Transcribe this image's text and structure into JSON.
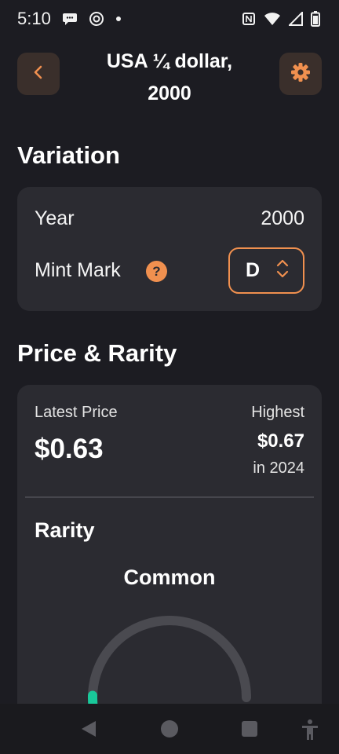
{
  "status_bar": {
    "time": "5:10"
  },
  "header": {
    "title_line1": "USA ¼ dollar,",
    "title_line2": "2000",
    "back_icon": "chevron-left-icon",
    "settings_icon": "gear-icon"
  },
  "variation": {
    "section_title": "Variation",
    "year_label": "Year",
    "year_value": "2000",
    "mint_mark_label": "Mint Mark",
    "help_symbol": "?",
    "mint_mark_value": "D"
  },
  "price_rarity": {
    "section_title": "Price & Rarity",
    "latest_price_label": "Latest Price",
    "latest_price_value": "$0.63",
    "highest_label": "Highest",
    "highest_value": "$0.67",
    "highest_year": "in 2024",
    "rarity_label": "Rarity",
    "rarity_value": "Common",
    "rarity_level": 0.05
  },
  "colors": {
    "background": "#1c1c22",
    "card": "#2b2b31",
    "accent": "#f0904f",
    "gauge_track": "#4a4a50",
    "gauge_fill": "#19c89a"
  }
}
